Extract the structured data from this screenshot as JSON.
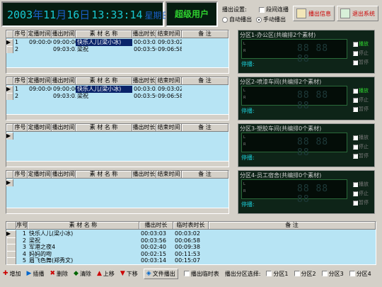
{
  "header": {
    "year": "2003",
    "y_lbl": "年",
    "month": "11",
    "m_lbl": "月",
    "day": "16",
    "d_lbl": "日",
    "time": "13:33:14",
    "weekday": "星期日",
    "user": "超级用户"
  },
  "settings": {
    "title": "播出设置:",
    "opt_interval": "段间连播",
    "opt_auto": "自动播出",
    "opt_manual": "手动播出",
    "btn_info": "播出信息",
    "btn_exit": "退出系统"
  },
  "table_cols": [
    "序号",
    "定播时间",
    "播出时间",
    "素 材 名 称",
    "播出时长",
    "结束时间",
    "备    注"
  ],
  "zones": [
    {
      "title": "分区1-办公区(共编排2个素材)",
      "play": "停播:",
      "rows": [
        {
          "n": "1",
          "sched": "09:00:00",
          "play": "09:00:00",
          "name": "快乐人儿(梁小冰)",
          "dur": "00:03:03",
          "end": "09:03:02",
          "note": ""
        },
        {
          "n": "2",
          "sched": "",
          "play": "09:03:03",
          "name": "梁祝",
          "dur": "00:03:56",
          "end": "09:06:58",
          "note": ""
        }
      ],
      "btns": [
        {
          "label": "播放",
          "on": true
        },
        {
          "label": "停止",
          "on": false
        },
        {
          "label": "暂停",
          "on": false
        }
      ]
    },
    {
      "title": "分区2-喷漆车间(共编排2个素材)",
      "play": "停播:",
      "rows": [
        {
          "n": "1",
          "sched": "09:00:00",
          "play": "09:00:00",
          "name": "快乐人儿(梁小冰)",
          "dur": "00:03:03",
          "end": "09:03:02",
          "note": ""
        },
        {
          "n": "2",
          "sched": "",
          "play": "09:03:03",
          "name": "梁祝",
          "dur": "00:03:56",
          "end": "09:06:58",
          "note": ""
        }
      ],
      "btns": [
        {
          "label": "播放",
          "on": true
        },
        {
          "label": "停止",
          "on": false
        },
        {
          "label": "暂停",
          "on": false
        }
      ]
    },
    {
      "title": "分区3-塑胶车间(共编排0个素材)",
      "play": "停播:",
      "rows": [],
      "btns": [
        {
          "label": "播放",
          "on": false
        },
        {
          "label": "停止",
          "on": false
        },
        {
          "label": "暂停",
          "on": false
        }
      ]
    },
    {
      "title": "分区4-员工宿舍(共编排0个素材)",
      "play": "停播:",
      "rows": [],
      "btns": [
        {
          "label": "播放",
          "on": false
        },
        {
          "label": "停止",
          "on": false
        },
        {
          "label": "暂停",
          "on": false
        }
      ]
    }
  ],
  "lcd_digits": "88 88 88",
  "lcd_lr": [
    "L",
    "R"
  ],
  "library": {
    "cols": [
      "序号",
      "素 材 名 称",
      "播出时长",
      "临时表时长",
      "备    注"
    ],
    "rows": [
      {
        "n": "1",
        "name": "快乐人儿(梁小冰)",
        "dur": "00:03:03",
        "tmp": "00:03:02",
        "note": ""
      },
      {
        "n": "2",
        "name": "梁祝",
        "dur": "00:03:56",
        "tmp": "00:06:58",
        "note": ""
      },
      {
        "n": "3",
        "name": "军港之夜4",
        "dur": "00:02:40",
        "tmp": "00:09:38",
        "note": ""
      },
      {
        "n": "4",
        "name": "妈妈的吻",
        "dur": "00:02:15",
        "tmp": "00:11:53",
        "note": ""
      },
      {
        "n": "5",
        "name": "眉飞色舞(郑秀文)",
        "dur": "00:03:14",
        "tmp": "00:15:07",
        "note": ""
      }
    ]
  },
  "toolbar": {
    "add": "增加",
    "insert": "插播",
    "del": "删除",
    "clear": "清除",
    "up": "上移",
    "down": "下移",
    "file_play": "文件播出",
    "tmp_table": "播出临时表",
    "zone_select": "播出分区选择:",
    "z1": "分区1",
    "z2": "分区2",
    "z3": "分区3",
    "z4": "分区4"
  }
}
